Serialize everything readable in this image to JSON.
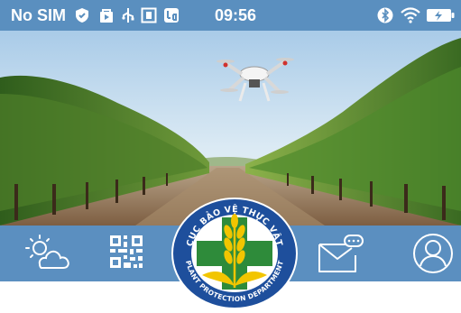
{
  "status_bar": {
    "carrier": "No SIM",
    "time": "09:56",
    "left_icons": [
      "shield-icon",
      "bag-icon",
      "usb-icon",
      "screenshot-icon",
      "app-icon"
    ],
    "right_icons": [
      "bluetooth-icon",
      "wifi-icon",
      "battery-charging-icon"
    ]
  },
  "hero": {
    "scene": "vineyard-with-drone"
  },
  "toolbar": {
    "buttons": [
      {
        "icon": "weather-icon"
      },
      {
        "icon": "qr-code-icon"
      },
      {
        "icon": "message-icon"
      },
      {
        "icon": "profile-icon"
      }
    ]
  },
  "logo": {
    "text_top": "CỤC BẢO VỆ THỰC VẬT",
    "text_bottom": "PLANT PROTECTION DEPARTMENT"
  },
  "colors": {
    "status_bar": "#5a8fbf",
    "toolbar": "#5b8fc0",
    "logo_blue": "#1e4f9c",
    "logo_green": "#2e8b3a",
    "logo_yellow": "#f2c500"
  }
}
